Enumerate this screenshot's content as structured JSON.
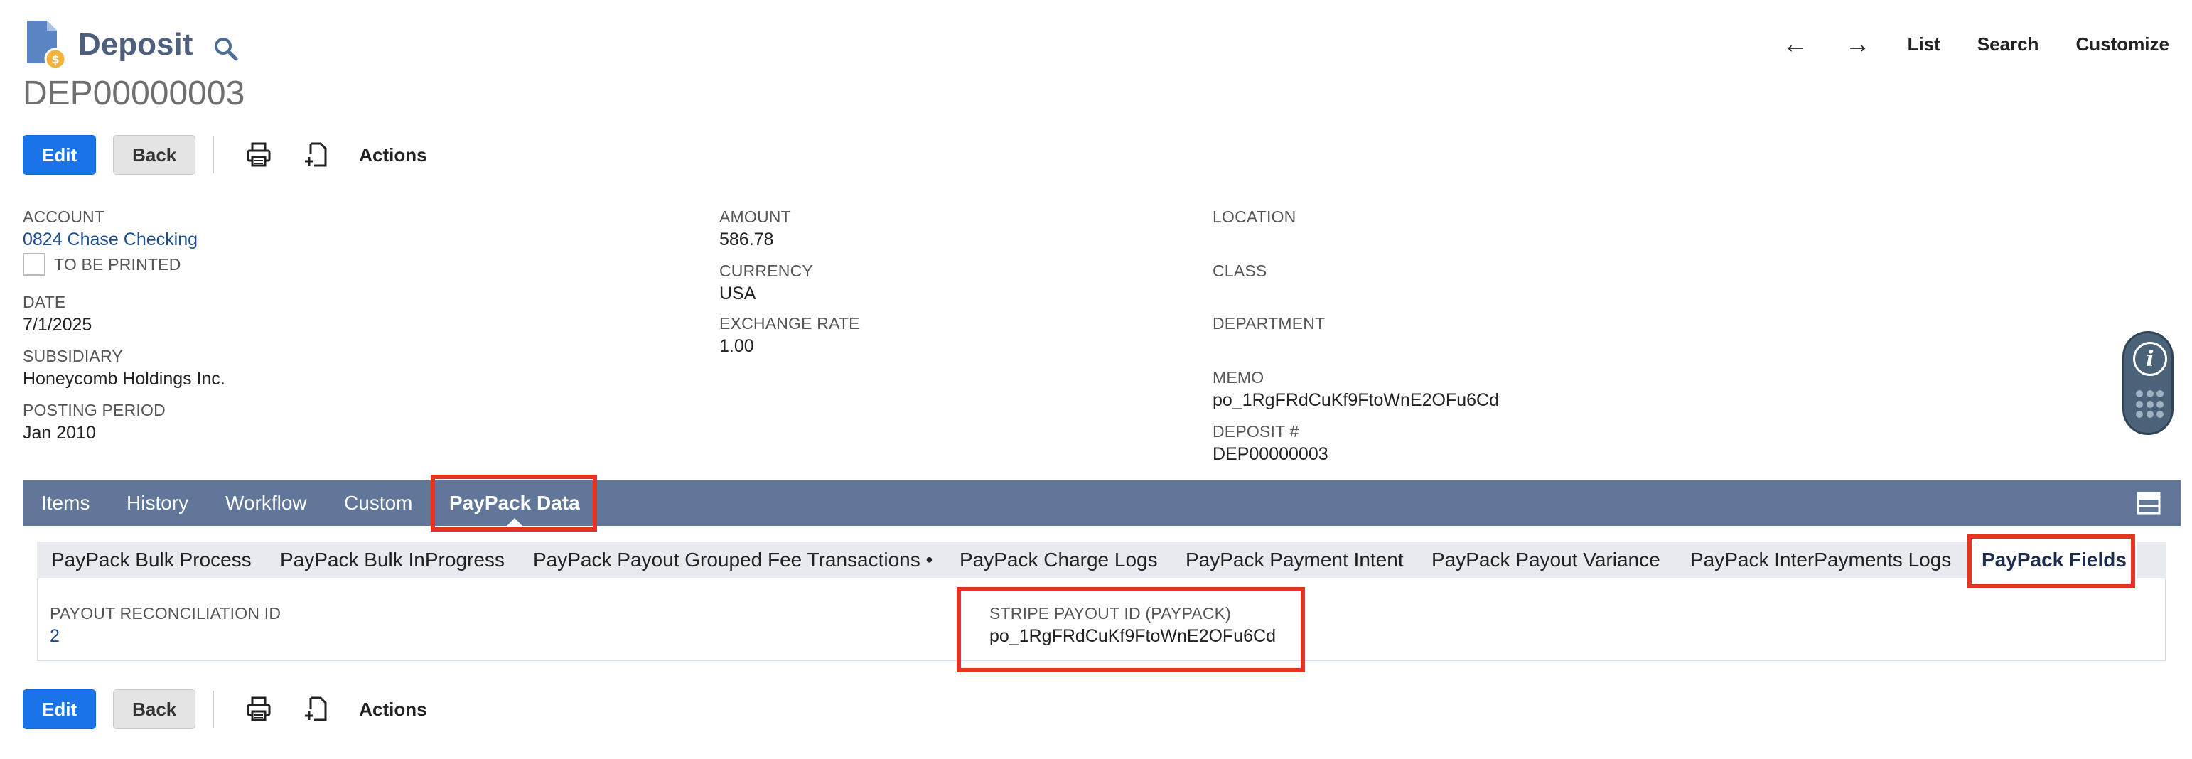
{
  "header": {
    "title": "Deposit",
    "record_id": "DEP00000003",
    "nav": {
      "list": "List",
      "search": "Search",
      "customize": "Customize"
    }
  },
  "toolbar": {
    "edit": "Edit",
    "back": "Back",
    "actions": "Actions"
  },
  "fields": {
    "account_label": "ACCOUNT",
    "account_value": "0824 Chase Checking",
    "to_be_printed_label": "TO BE PRINTED",
    "date_label": "DATE",
    "date_value": "7/1/2025",
    "subsidiary_label": "SUBSIDIARY",
    "subsidiary_value": "Honeycomb Holdings Inc.",
    "posting_period_label": "POSTING PERIOD",
    "posting_period_value": "Jan 2010",
    "amount_label": "AMOUNT",
    "amount_value": "586.78",
    "currency_label": "CURRENCY",
    "currency_value": "USA",
    "exchange_rate_label": "EXCHANGE RATE",
    "exchange_rate_value": "1.00",
    "location_label": "LOCATION",
    "class_label": "CLASS",
    "department_label": "DEPARTMENT",
    "memo_label": "MEMO",
    "memo_value": "po_1RgFRdCuKf9FtoWnE2OFu6Cd",
    "deposit_num_label": "DEPOSIT #",
    "deposit_num_value": "DEP00000003"
  },
  "tabs": [
    {
      "label": "Items"
    },
    {
      "label": "History"
    },
    {
      "label": "Workflow"
    },
    {
      "label": "Custom"
    },
    {
      "label": "PayPack Data"
    }
  ],
  "subtabs": [
    {
      "label": "PayPack Bulk Process"
    },
    {
      "label": "PayPack Bulk InProgress"
    },
    {
      "label": "PayPack Payout Grouped Fee Transactions •"
    },
    {
      "label": "PayPack Charge Logs"
    },
    {
      "label": "PayPack Payment Intent"
    },
    {
      "label": "PayPack Payout Variance"
    },
    {
      "label": "PayPack InterPayments Logs"
    },
    {
      "label": "PayPack Fields"
    }
  ],
  "paypack_fields": {
    "payout_recon_label": "PAYOUT RECONCILIATION ID",
    "payout_recon_value": "2",
    "stripe_payout_label": "STRIPE PAYOUT ID (PAYPACK)",
    "stripe_payout_value": "po_1RgFRdCuKf9FtoWnE2OFu6Cd"
  },
  "colors": {
    "primary_button": "#1a73e8",
    "tab_bar": "#607799",
    "link": "#1d4e8f",
    "highlight": "#e53221"
  },
  "icons": {
    "title_icon": "deposit-document-icon",
    "title_search": "search-icon",
    "print": "print-icon",
    "new_document": "new-document-icon",
    "info": "info-icon",
    "apps": "grid-dots-icon",
    "layout": "layout-toggle-icon"
  }
}
